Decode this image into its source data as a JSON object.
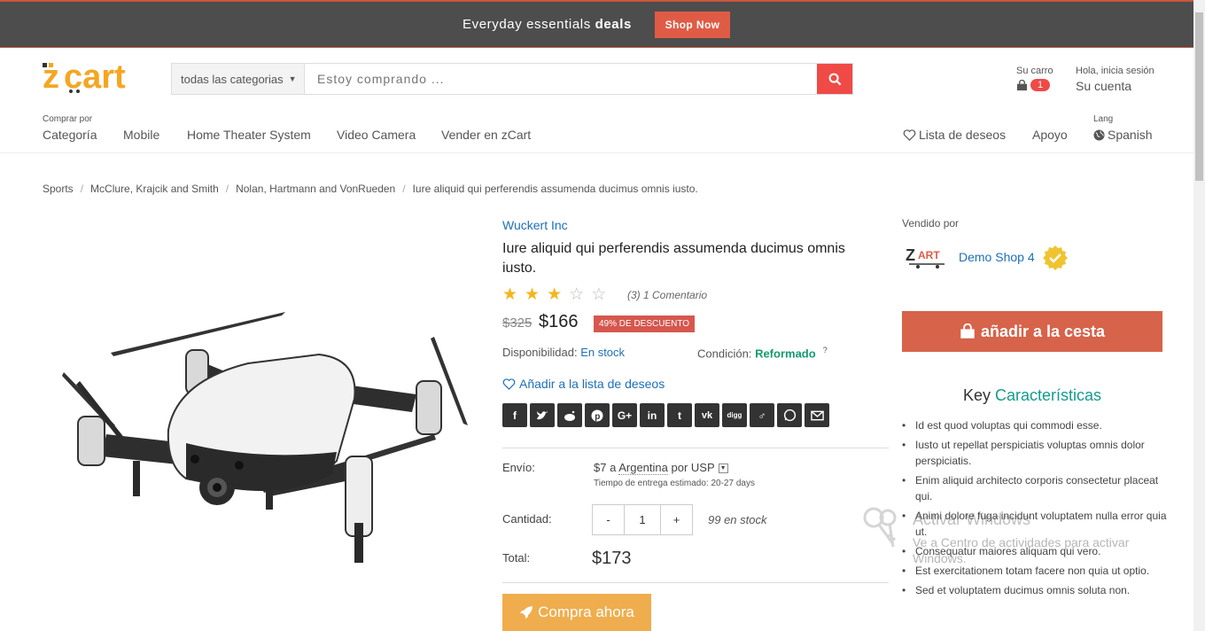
{
  "banner": {
    "text_prefix": "Everyday essentials",
    "text_bold": "deals",
    "button": "Shop Now"
  },
  "header": {
    "search": {
      "category": "todas las categorias",
      "placeholder": "Estoy comprando ..."
    },
    "cart": {
      "label": "Su carro",
      "count": "1"
    },
    "account": {
      "label": "Hola, inicia sesión",
      "link": "Su cuenta"
    }
  },
  "nav": {
    "browse_small": "Comprar por",
    "browse": "Categoría",
    "items": [
      "Mobile",
      "Home Theater System",
      "Video Camera",
      "Vender en zCart"
    ],
    "wishlist": "Lista de deseos",
    "support": "Apoyo",
    "lang_small": "Lang",
    "lang": "Spanish"
  },
  "breadcrumb": [
    "Sports",
    "McClure, Krajcik and Smith",
    "Nolan, Hartmann and VonRueden",
    "Iure aliquid qui perferendis assumenda ducimus omnis iusto."
  ],
  "product": {
    "brand": "Wuckert Inc",
    "title": "Iure aliquid qui perferendis assumenda ducimus omnis iusto.",
    "rating": 3,
    "rating_max": 5,
    "rating_text": "(3) 1 Comentario",
    "old_price": "$325",
    "price": "$166",
    "discount": "49% DE DESCUENTO",
    "availability_label": "Disponibilidad:",
    "availability": "En stock",
    "condition_label": "Condición:",
    "condition": "Reformado",
    "condition_help": "?",
    "wishlist": "Añadir a la lista de deseos",
    "shipping_label": "Envío:",
    "shipping_price": "$7 a",
    "shipping_country": "Argentina",
    "shipping_via": "por USP",
    "shipping_time": "Tiempo de entrega estimado: 20-27 days",
    "quantity_label": "Cantidad:",
    "quantity": "1",
    "qty_minus": "-",
    "qty_plus": "+",
    "stock": "99 en stock",
    "total_label": "Total:",
    "total": "$173",
    "buy_now": "Compra ahora"
  },
  "shares": [
    "facebook-icon",
    "twitter-icon",
    "reddit-icon",
    "pinterest-icon",
    "google-plus-icon",
    "linkedin-icon",
    "tumblr-icon",
    "vk-icon",
    "digg-icon",
    "odnoklassniki-icon",
    "whatsapp-icon",
    "email-icon"
  ],
  "seller": {
    "sold_by": "Vendido por",
    "name": "Demo Shop 4",
    "add_to_cart": "añadir a la cesta"
  },
  "features": {
    "title_a": "Key",
    "title_b": "Características",
    "items": [
      "Id est quod voluptas qui commodi esse.",
      "Iusto ut repellat perspiciatis voluptas omnis dolor perspiciatis.",
      "Enim aliquid architecto corporis consectetur placeat qui.",
      "Animi dolore fuga incidunt voluptatem nulla error quia ut.",
      "Consequatur maiores aliquam qui vero.",
      "Est exercitationem totam facere non quia ut optio.",
      "Sed et voluptatem ducimus omnis soluta non."
    ]
  },
  "watermark": {
    "title": "Activar Windows",
    "subtitle": "Ve a Centro de actividades para activar Windows."
  },
  "colors": {
    "accent": "#d6634a",
    "link": "#1d6fb8",
    "search": "#f04a46",
    "buy": "#f0ad4e",
    "success": "#149b6e"
  }
}
